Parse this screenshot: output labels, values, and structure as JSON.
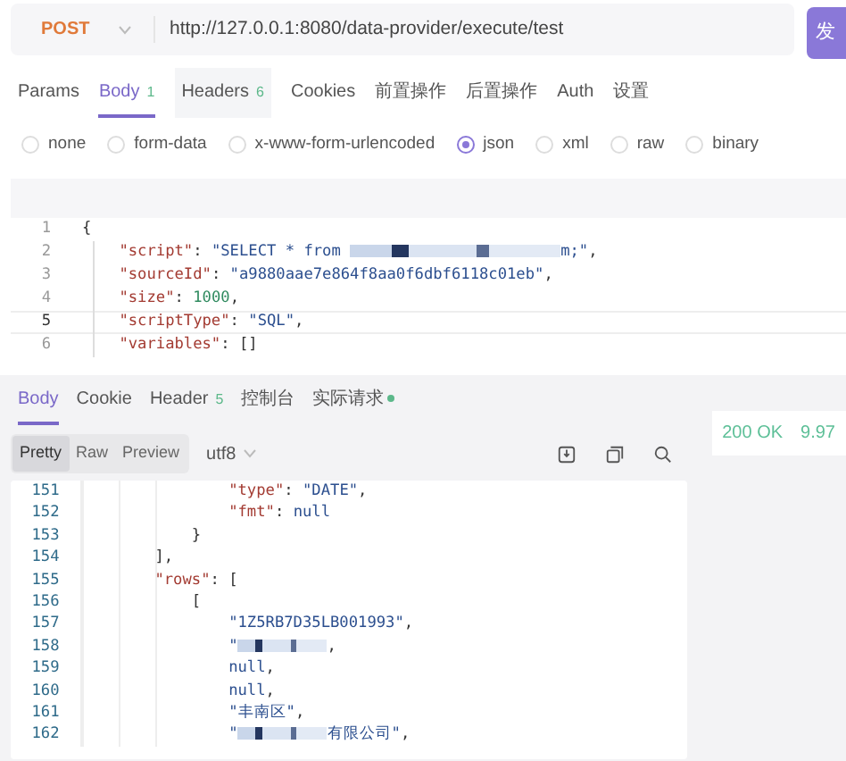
{
  "request": {
    "method": "POST",
    "url": "http://127.0.0.1:8080/data-provider/execute/test",
    "send_label": "发"
  },
  "request_tabs": [
    {
      "label": "Params",
      "selected": false
    },
    {
      "label": "Body",
      "count": "1",
      "selected": true
    },
    {
      "label": "Headers",
      "count": "6",
      "selected": false
    },
    {
      "label": "Cookies",
      "selected": false
    },
    {
      "label": "前置操作",
      "selected": false
    },
    {
      "label": "后置操作",
      "selected": false
    },
    {
      "label": "Auth",
      "selected": false
    },
    {
      "label": "设置",
      "selected": false
    }
  ],
  "body_types": [
    {
      "label": "none",
      "selected": false
    },
    {
      "label": "form-data",
      "selected": false
    },
    {
      "label": "x-www-form-urlencoded",
      "selected": false
    },
    {
      "label": "json",
      "selected": true
    },
    {
      "label": "xml",
      "selected": false
    },
    {
      "label": "raw",
      "selected": false
    },
    {
      "label": "binary",
      "selected": false
    }
  ],
  "request_body": [
    {
      "number": "1",
      "active": false,
      "tokens": [
        {
          "kind": "punct",
          "text": "{"
        }
      ]
    },
    {
      "number": "2",
      "active": false,
      "tokens": [
        {
          "kind": "key",
          "text": "    \"script\""
        },
        {
          "kind": "punct",
          "text": ": "
        },
        {
          "kind": "str",
          "text": "\"SELECT * from "
        },
        {
          "kind": "mask"
        },
        {
          "kind": "str",
          "text": "m;\""
        },
        {
          "kind": "punct",
          "text": ","
        }
      ]
    },
    {
      "number": "3",
      "active": false,
      "tokens": [
        {
          "kind": "key",
          "text": "    \"sourceId\""
        },
        {
          "kind": "punct",
          "text": ": "
        },
        {
          "kind": "str",
          "text": "\"a9880aae7e864f8aa0f6dbf6118c01eb\""
        },
        {
          "kind": "punct",
          "text": ","
        }
      ]
    },
    {
      "number": "4",
      "active": false,
      "tokens": [
        {
          "kind": "key",
          "text": "    \"size\""
        },
        {
          "kind": "punct",
          "text": ": "
        },
        {
          "kind": "num",
          "text": "1000"
        },
        {
          "kind": "punct",
          "text": ","
        }
      ]
    },
    {
      "number": "5",
      "active": true,
      "tokens": [
        {
          "kind": "key",
          "text": "    \"scriptType\""
        },
        {
          "kind": "punct",
          "text": ": "
        },
        {
          "kind": "str",
          "text": "\"SQL\""
        },
        {
          "kind": "punct",
          "text": ","
        }
      ]
    },
    {
      "number": "6",
      "active": false,
      "tokens": [
        {
          "kind": "key",
          "text": "    \"variables\""
        },
        {
          "kind": "punct",
          "text": ": []"
        }
      ]
    }
  ],
  "response_tabs": [
    {
      "label": "Body",
      "selected": true,
      "dot": false
    },
    {
      "label": "Cookie",
      "selected": false,
      "dot": false
    },
    {
      "label": "Header",
      "count": "5",
      "selected": false,
      "dot": false
    },
    {
      "label": "控制台",
      "selected": false,
      "dot": false
    },
    {
      "label": "实际请求",
      "selected": false,
      "dot": true
    }
  ],
  "format_tabs": [
    {
      "label": "Pretty",
      "selected": true
    },
    {
      "label": "Raw",
      "selected": false
    },
    {
      "label": "Preview",
      "selected": false
    }
  ],
  "encoding": "utf8",
  "status": "200 OK",
  "time": "9.97",
  "response_body": [
    {
      "number": "151",
      "tokens": [
        {
          "kind": "key",
          "text": "            \"type\""
        },
        {
          "kind": "punct",
          "text": ": "
        },
        {
          "kind": "str",
          "text": "\"DATE\""
        },
        {
          "kind": "punct",
          "text": ","
        }
      ]
    },
    {
      "number": "152",
      "tokens": [
        {
          "kind": "key",
          "text": "            \"fmt\""
        },
        {
          "kind": "punct",
          "text": ": "
        },
        {
          "kind": "null",
          "text": "null"
        }
      ]
    },
    {
      "number": "153",
      "tokens": [
        {
          "kind": "punct",
          "text": "        }"
        }
      ]
    },
    {
      "number": "154",
      "tokens": [
        {
          "kind": "punct",
          "text": "    ],"
        }
      ]
    },
    {
      "number": "155",
      "tokens": [
        {
          "kind": "key",
          "text": "    \"rows\""
        },
        {
          "kind": "punct",
          "text": ": ["
        }
      ]
    },
    {
      "number": "156",
      "tokens": [
        {
          "kind": "punct",
          "text": "        ["
        }
      ]
    },
    {
      "number": "157",
      "tokens": [
        {
          "kind": "str",
          "text": "            \"1Z5RB7D35LB001993\""
        },
        {
          "kind": "punct",
          "text": ","
        }
      ]
    },
    {
      "number": "158",
      "tokens": [
        {
          "kind": "str",
          "text": "            \""
        },
        {
          "kind": "mask"
        },
        {
          "kind": "punct",
          "text": ","
        }
      ]
    },
    {
      "number": "159",
      "tokens": [
        {
          "kind": "null",
          "text": "            null"
        },
        {
          "kind": "punct",
          "text": ","
        }
      ]
    },
    {
      "number": "160",
      "tokens": [
        {
          "kind": "null",
          "text": "            null"
        },
        {
          "kind": "punct",
          "text": ","
        }
      ]
    },
    {
      "number": "161",
      "tokens": [
        {
          "kind": "str",
          "text": "            \"丰南区\""
        },
        {
          "kind": "punct",
          "text": ","
        }
      ]
    },
    {
      "number": "162",
      "tokens": [
        {
          "kind": "str",
          "text": "            \""
        },
        {
          "kind": "mask"
        },
        {
          "kind": "str",
          "text": "有限公司\""
        },
        {
          "kind": "punct",
          "text": ","
        }
      ]
    }
  ]
}
